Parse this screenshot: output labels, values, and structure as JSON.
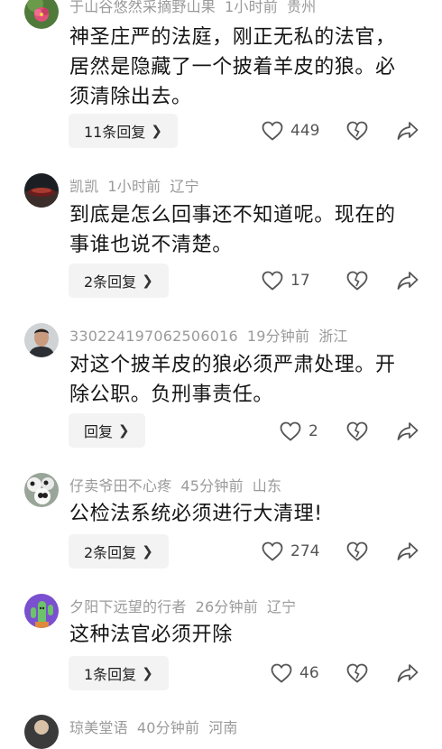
{
  "comments": [
    {
      "user": "于山谷悠然采摘野山果",
      "time": "1小时前",
      "location": "贵州",
      "text": "神圣庄严的法庭，刚正无私的法官，居然是隐藏了一个披着羊皮的狼。必须清除出去。",
      "replies": "11条回复",
      "likes": "449",
      "avatar": "flower-photo"
    },
    {
      "user": "凯凯",
      "time": "1小时前",
      "location": "辽宁",
      "text": "到底是怎么回事还不知道呢。现在的事谁也说不清楚。",
      "replies": "2条回复",
      "likes": "17",
      "avatar": "car-photo"
    },
    {
      "user": "330224197062506016",
      "time": "19分钟前",
      "location": "浙江",
      "text": "对这个披羊皮的狼必须严肃处理。开除公职。负刑事责任。",
      "replies": "回复",
      "likes": "2",
      "avatar": "man-photo"
    },
    {
      "user": "仔卖爷田不心疼",
      "time": "45分钟前",
      "location": "山东",
      "text": "公检法系统必须进行大清理!",
      "replies": "2条回复",
      "likes": "274",
      "avatar": "panda-photo"
    },
    {
      "user": "夕阳下远望的行者",
      "time": "26分钟前",
      "location": "辽宁",
      "text": "这种法官必须开除",
      "replies": "1条回复",
      "likes": "46",
      "avatar": "cactus-cartoon"
    },
    {
      "user": "琼美堂语",
      "time": "40分钟前",
      "location": "河南",
      "avatar": "partial-avatar"
    }
  ],
  "icons": {
    "like": "heart-outline-icon",
    "dislike": "broken-heart-icon",
    "share": "share-arrow-icon",
    "chevron": "chevron-right-icon"
  },
  "colors": {
    "meta": "#9a9a9a",
    "text": "#151515",
    "button_bg": "#f3f3f3"
  }
}
